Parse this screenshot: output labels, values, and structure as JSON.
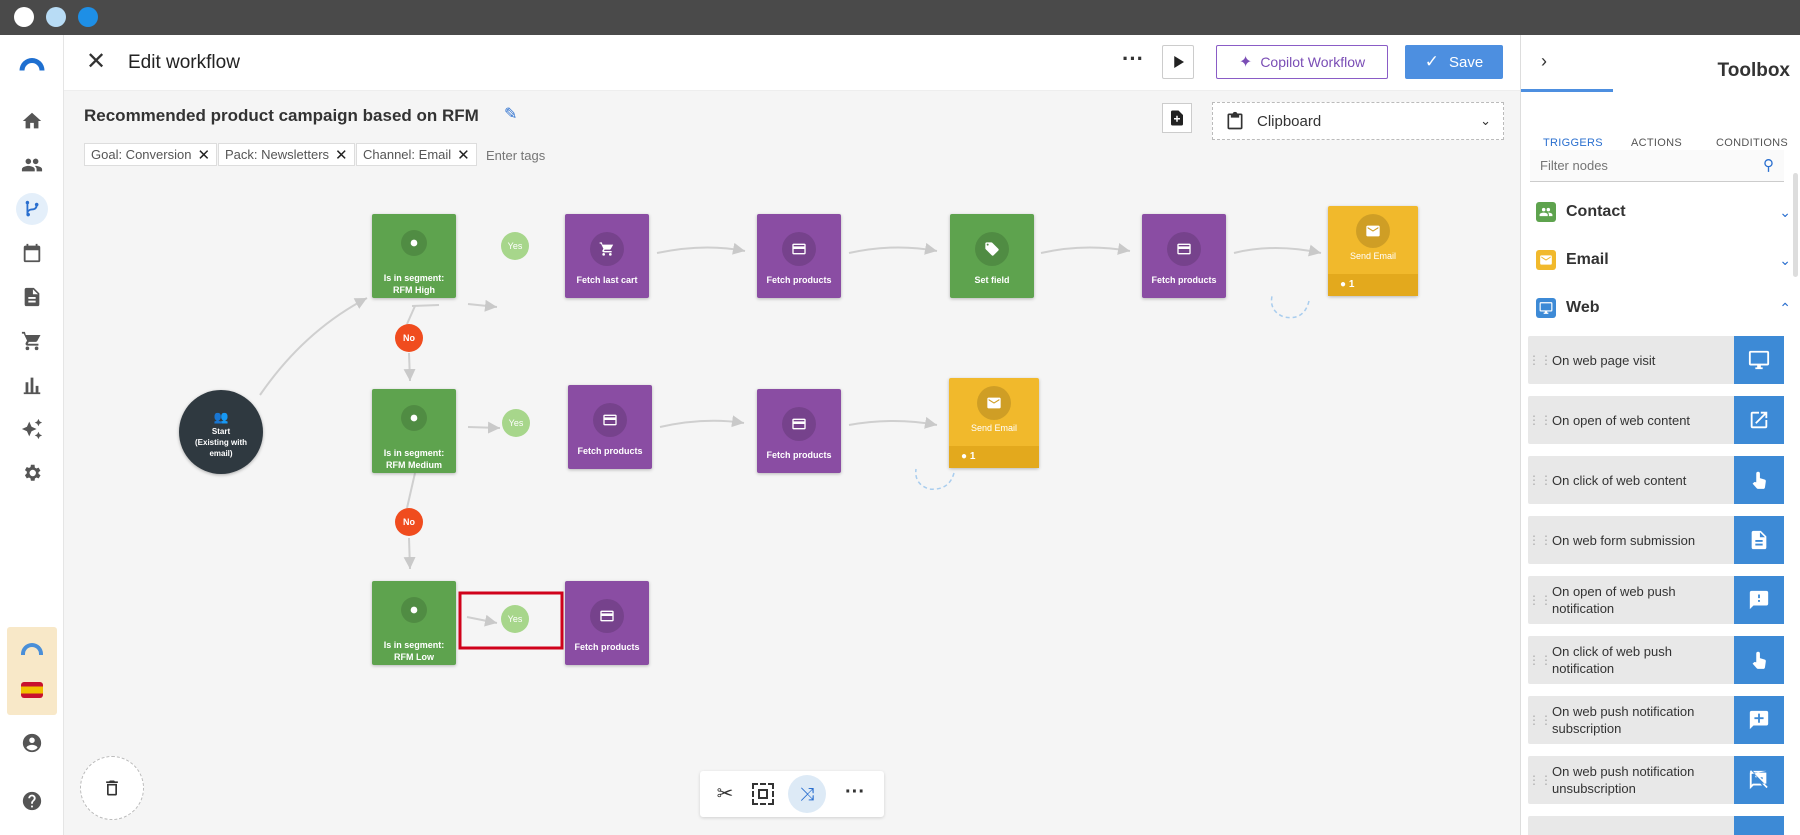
{
  "header": {
    "title": "Edit workflow",
    "copilot_label": "Copilot Workflow",
    "save_label": "Save"
  },
  "workflow": {
    "name": "Recommended product campaign based on RFM",
    "tags": [
      "Goal: Conversion",
      "Pack: Newsletters",
      "Channel: Email"
    ],
    "tag_placeholder": "Enter tags",
    "clipboard_label": "Clipboard"
  },
  "nodes": {
    "start": "Start (Existing with email)",
    "seg_high": "Is in segment: RFM High",
    "seg_medium": "Is in segment: RFM Medium",
    "seg_low": "Is in segment: RFM Low",
    "fetch_last_cart": "Fetch last cart",
    "fetch_products": "Fetch products",
    "set_field": "Set field",
    "send_email": "Send Email",
    "email_count_1": "1",
    "email_count_2": "1",
    "yes": "Yes",
    "no": "No"
  },
  "toolbox": {
    "title": "Toolbox",
    "tabs": [
      "TRIGGERS",
      "ACTIONS",
      "CONDITIONS"
    ],
    "filter_placeholder": "Filter nodes",
    "categories": [
      "Contact",
      "Email",
      "Web"
    ],
    "items": [
      "On web page visit",
      "On open of web content",
      "On click of web content",
      "On web form submission",
      "On open of web push notification",
      "On click of web push notification",
      "On web push notification subscription",
      "On web push notification unsubscription"
    ]
  },
  "colors": {
    "trigger_accent": "#2a6fcf",
    "condition_green": "#5ea34e",
    "action_purple": "#8a4da3",
    "email_yellow": "#f1b92c",
    "no_badge": "#f04c1e",
    "yes_badge": "#a7d68b",
    "save_button": "#4d8fe0"
  }
}
